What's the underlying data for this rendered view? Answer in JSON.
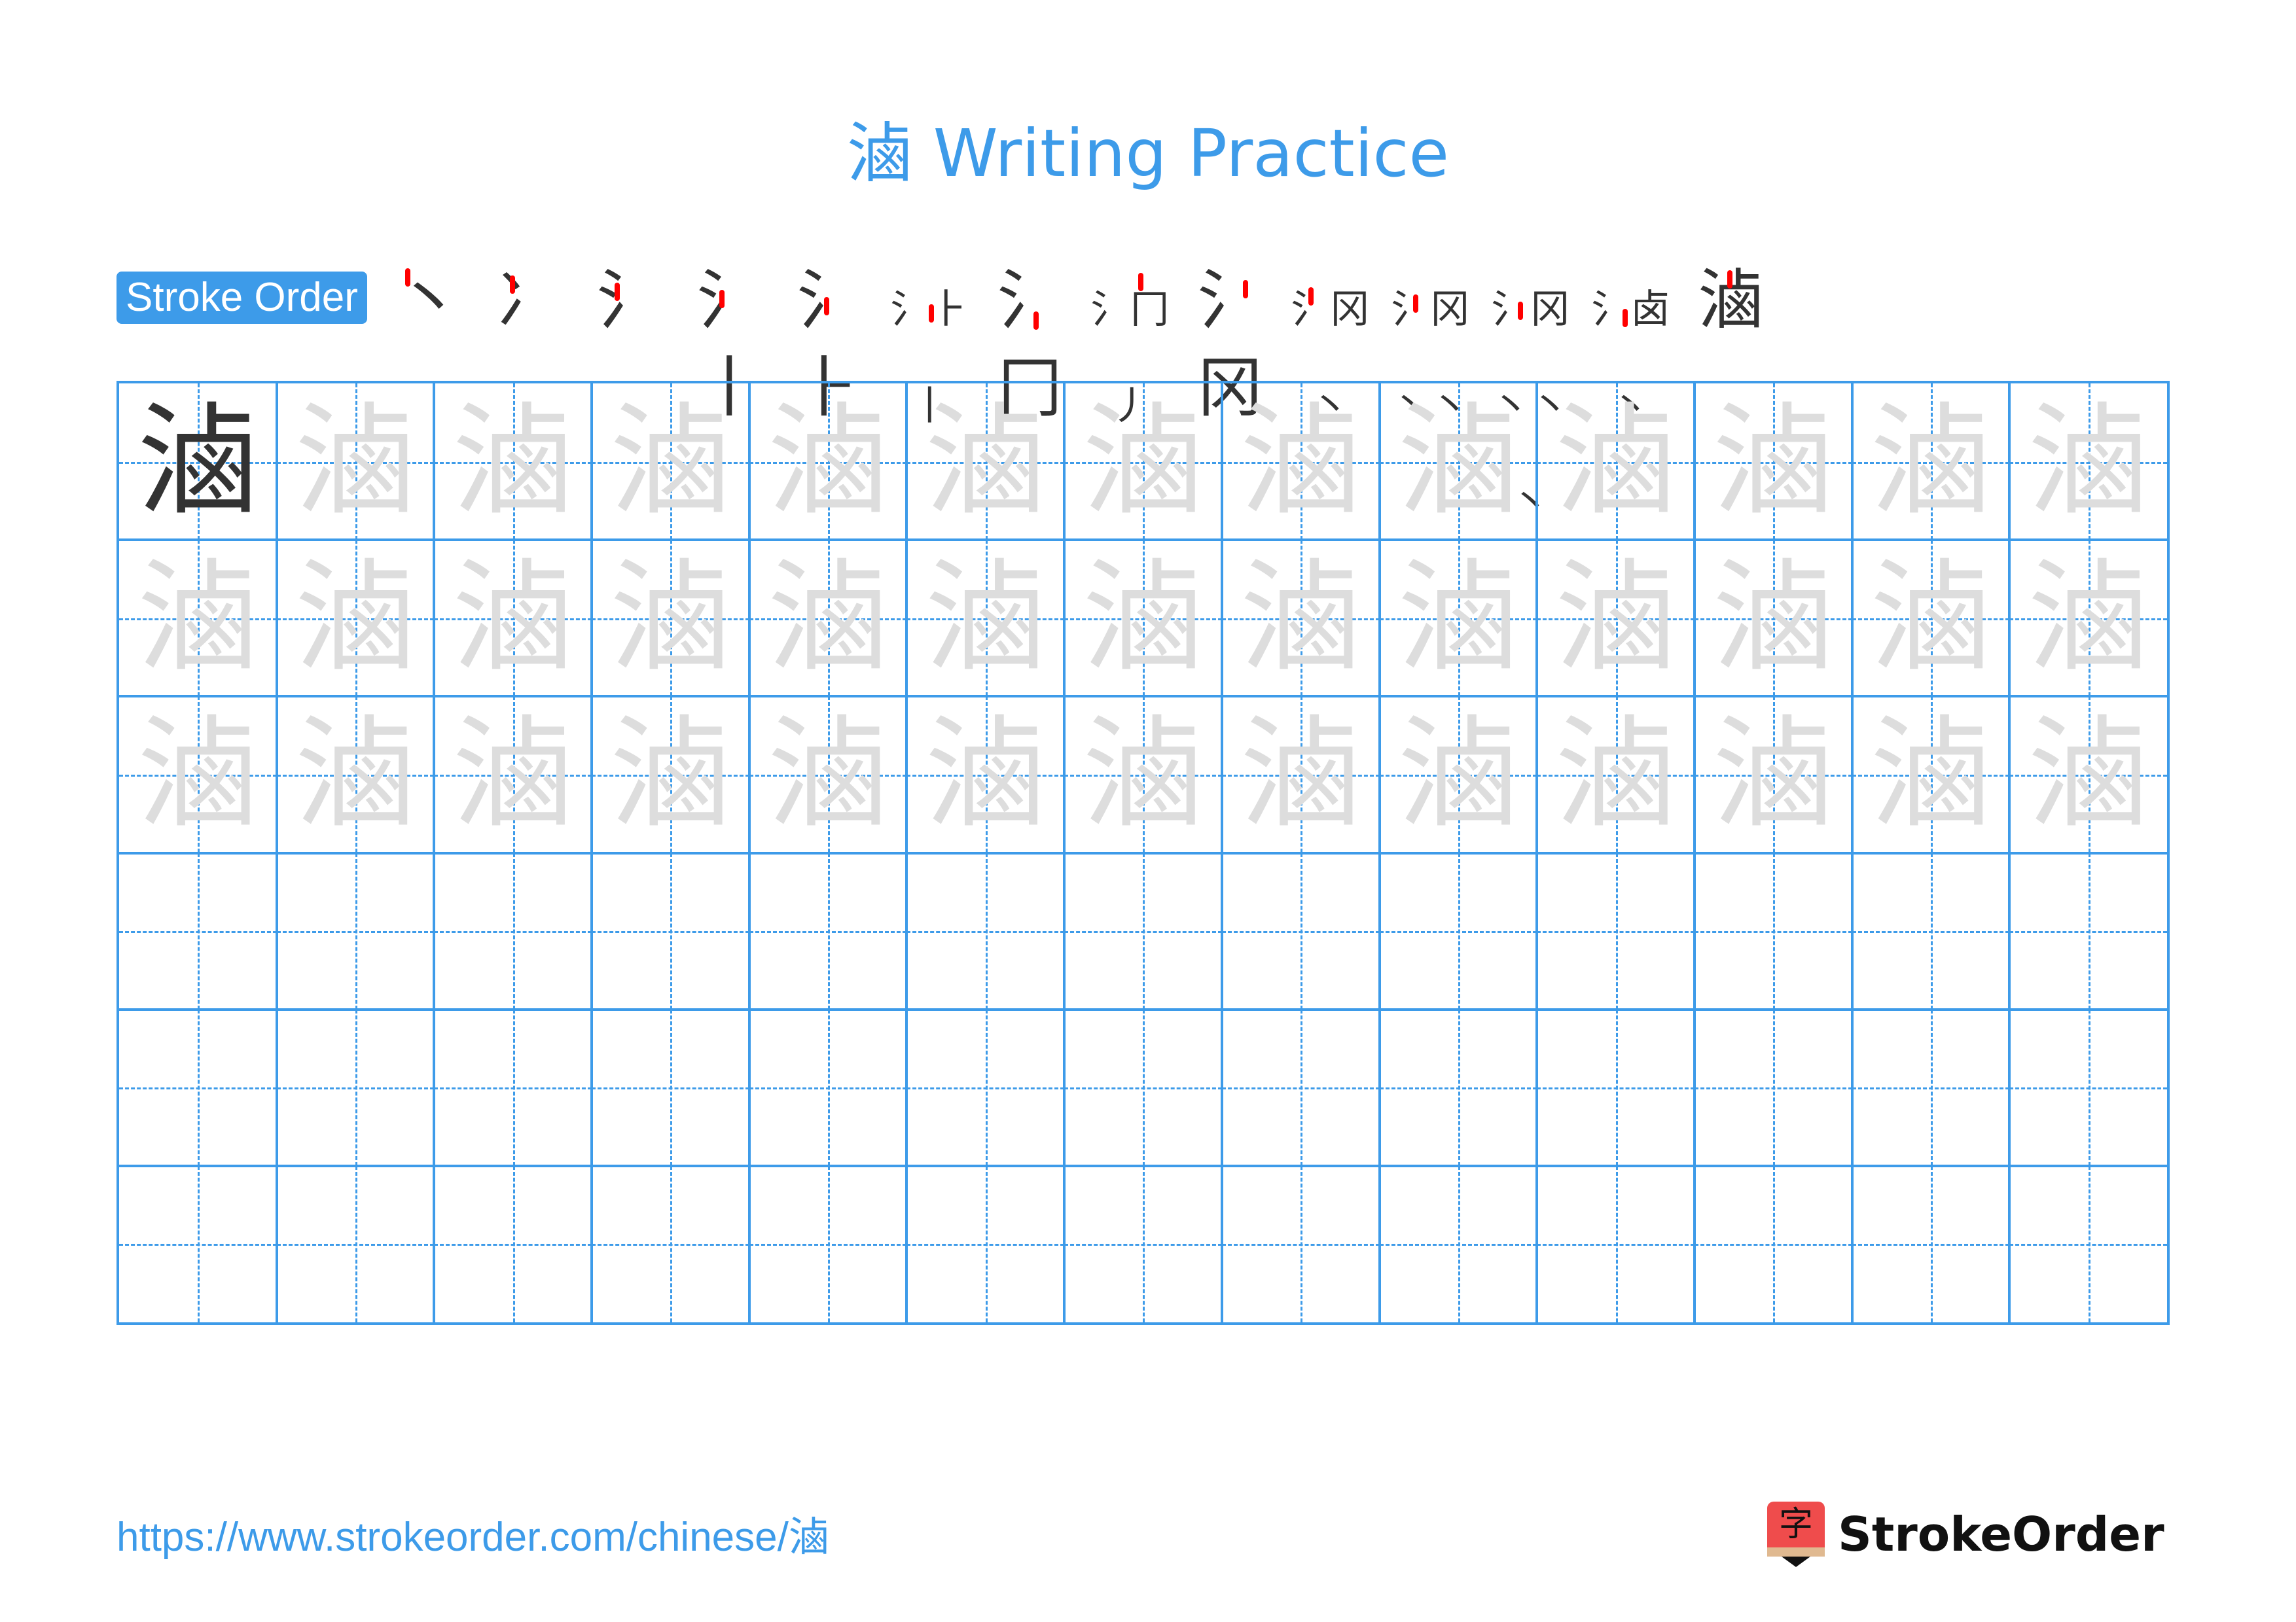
{
  "title": "滷 Writing Practice",
  "character": "滷",
  "stroke_order": {
    "label": "Stroke Order",
    "steps": [
      {
        "glyph": "丶",
        "highlight": "stroke 1"
      },
      {
        "glyph": "冫",
        "highlight": "stroke 2"
      },
      {
        "glyph": "氵",
        "highlight": "stroke 3"
      },
      {
        "glyph": "氵丨",
        "highlight": "stroke 4"
      },
      {
        "glyph": "氵⺊",
        "highlight": "stroke 5"
      },
      {
        "glyph": "氵⺊丨",
        "highlight": "stroke 6"
      },
      {
        "glyph": "氵冂",
        "highlight": "stroke 7"
      },
      {
        "glyph": "氵冂丿",
        "highlight": "stroke 8"
      },
      {
        "glyph": "氵冈",
        "highlight": "stroke 9"
      },
      {
        "glyph": "氵冈丶",
        "highlight": "stroke 10"
      },
      {
        "glyph": "氵冈丶丶",
        "highlight": "stroke 11"
      },
      {
        "glyph": "氵冈丶丶丶",
        "highlight": "stroke 12"
      },
      {
        "glyph": "氵卤丶",
        "highlight": "stroke 13"
      },
      {
        "glyph": "滷",
        "highlight": "stroke 14"
      }
    ]
  },
  "grid": {
    "columns": 13,
    "rows": 6,
    "model_cells": 1,
    "trace_rows": 3,
    "line_color": "#3d9be9",
    "model_color": "#333333",
    "trace_color": "#dddddd"
  },
  "footer": {
    "url": "https://www.strokeorder.com/chinese/滷",
    "brand_name": "StrokeOrder",
    "brand_logo_glyph": "字"
  },
  "colors": {
    "accent": "#3d9be9",
    "stroke_highlight": "#ff0000",
    "logo_red": "#ef4c4c"
  }
}
